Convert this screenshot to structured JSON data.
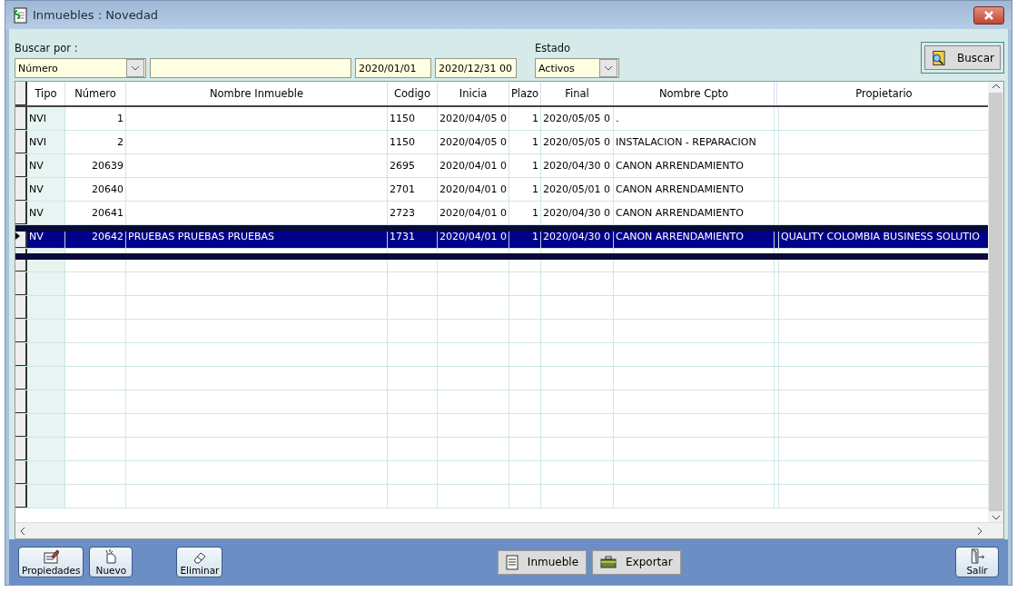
{
  "window": {
    "title": "Inmuebles : Novedad"
  },
  "search": {
    "label": "Buscar por :",
    "field": "Número",
    "date_from": "2020/01/01",
    "date_to": "2020/12/31 00"
  },
  "status": {
    "label": "Estado",
    "value": "Activos"
  },
  "search_button": "Buscar",
  "table": {
    "columns": [
      "Tipo",
      "Número",
      "Nombre Inmueble",
      "Codigo",
      "Inicia",
      "Plazo",
      "Final",
      "Nombre Cpto",
      "",
      "Propietario"
    ],
    "rows": [
      {
        "cells": [
          "NVI",
          "1",
          "",
          "1150",
          "2020/04/05 0",
          "1",
          "2020/05/05 0",
          ".",
          "",
          ""
        ],
        "selected": false
      },
      {
        "cells": [
          "NVI",
          "2",
          "",
          "1150",
          "2020/04/05 0",
          "1",
          "2020/05/05 0",
          "INSTALACION - REPARACION",
          "",
          ""
        ],
        "selected": false
      },
      {
        "cells": [
          "NV",
          "20639",
          "",
          "2695",
          "2020/04/01 0",
          "1",
          "2020/04/30 0",
          "CANON ARRENDAMIENTO",
          "",
          ""
        ],
        "selected": false
      },
      {
        "cells": [
          "NV",
          "20640",
          "",
          "2701",
          "2020/04/01 0",
          "1",
          "2020/05/01 0",
          "CANON ARRENDAMIENTO",
          "",
          ""
        ],
        "selected": false
      },
      {
        "cells": [
          "NV",
          "20641",
          "",
          "2723",
          "2020/04/01 0",
          "1",
          "2020/04/30 0",
          "CANON ARRENDAMIENTO",
          "",
          ""
        ],
        "selected": false
      },
      {
        "cells": [
          "NV",
          "20642",
          "PRUEBAS PRUEBAS PRUEBAS",
          "1731",
          "2020/04/01 0",
          "1",
          "2020/04/30 0",
          "CANON ARRENDAMIENTO",
          "",
          "QUALITY COLOMBIA BUSINESS SOLUTIO"
        ],
        "selected": true
      }
    ]
  },
  "buttons": [
    {
      "label": "Propiedades",
      "kind": "tool"
    },
    {
      "label": "Nuevo",
      "kind": "tool"
    },
    {
      "label": "Eliminar",
      "kind": "tool"
    },
    {
      "label": "Inmueble",
      "kind": "flat"
    },
    {
      "label": "Exportar",
      "kind": "flat"
    },
    {
      "label": "Salir",
      "kind": "tool"
    }
  ]
}
